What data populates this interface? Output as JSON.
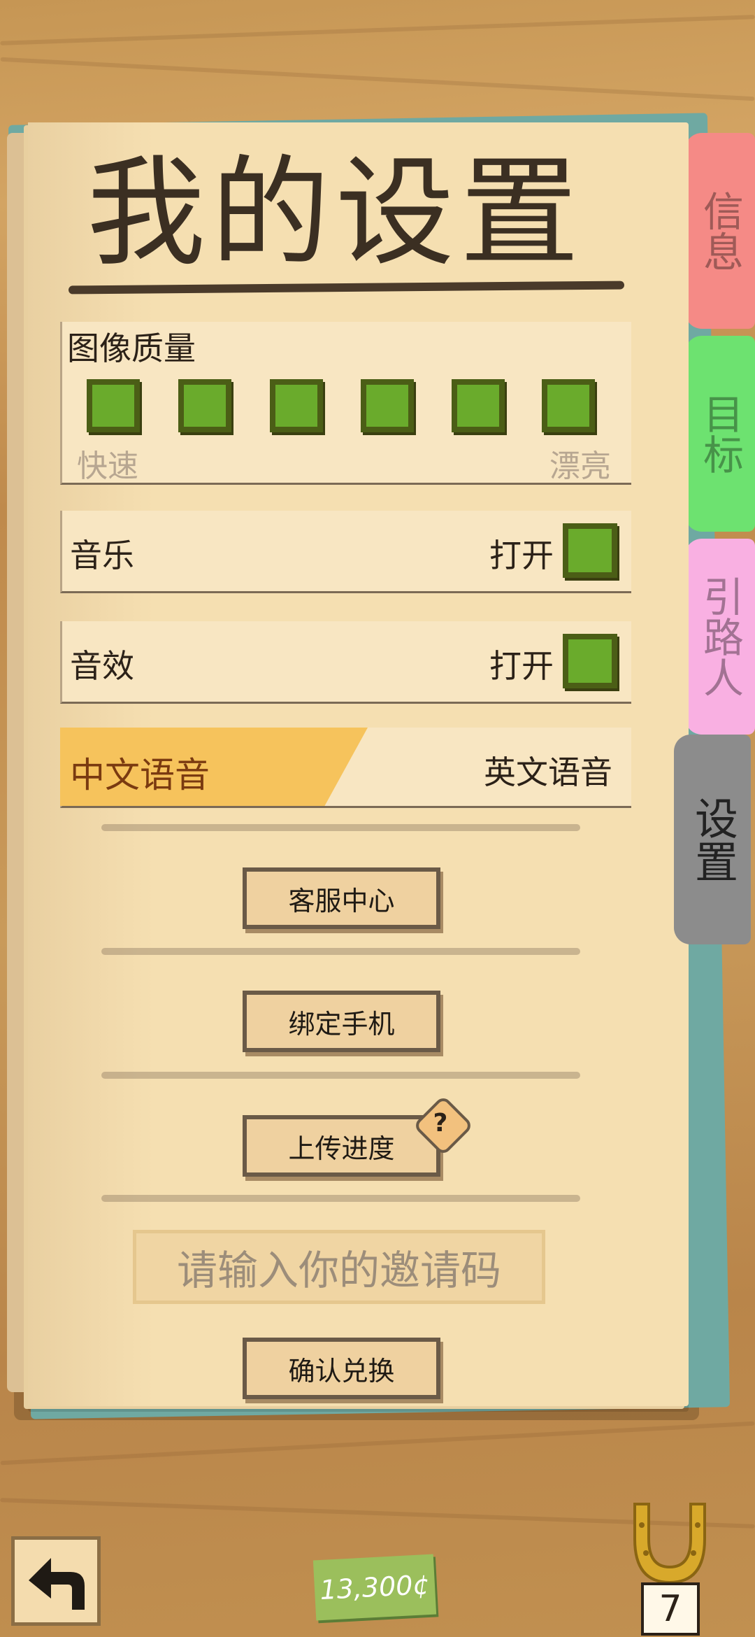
{
  "title": "我的设置",
  "tabs": [
    {
      "label": "信息",
      "color": "#f58a86"
    },
    {
      "label": "目标",
      "color": "#6de270"
    },
    {
      "label": "引路人",
      "color": "#f9b0e2"
    },
    {
      "label": "设置",
      "color": "#8c8c8c"
    }
  ],
  "quality": {
    "label": "图像质量",
    "left": "快速",
    "right": "漂亮",
    "levels_selected": 6,
    "levels_total": 6
  },
  "music": {
    "label": "音乐",
    "state": "打开"
  },
  "sfx": {
    "label": "音效",
    "state": "打开"
  },
  "language": {
    "active": "中文语音",
    "inactive": "英文语音"
  },
  "buttons": {
    "support": "客服中心",
    "bind_phone": "绑定手机",
    "upload": "上传进度",
    "help_mark": "?",
    "redeem": "确认兑换"
  },
  "invite_placeholder": "请输入你的邀请码",
  "bottom_bar": {
    "currency": "13,300¢",
    "horseshoes": "7"
  },
  "icons": {
    "back": "back-arrow-icon",
    "horseshoe": "horseshoe-icon"
  }
}
